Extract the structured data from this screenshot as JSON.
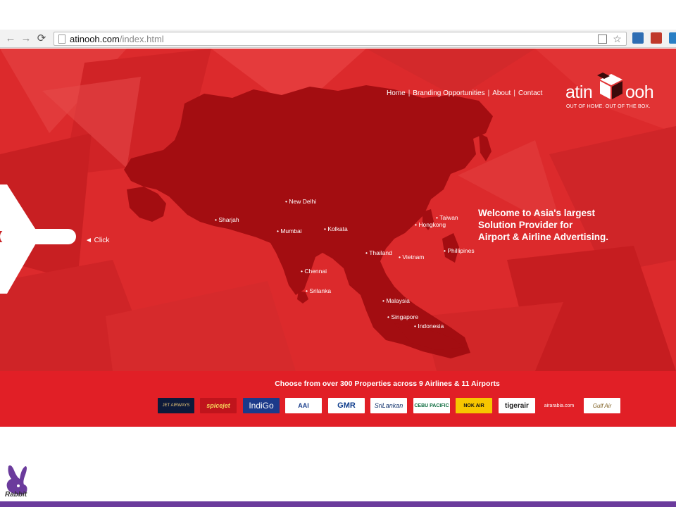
{
  "browser": {
    "url_host": "atinooh.com",
    "url_path": "/index.html",
    "icons": [
      "back-icon",
      "forward-icon",
      "reload-icon",
      "page-icon",
      "bookmark-star-icon"
    ]
  },
  "site": {
    "nav": [
      {
        "label": "Home"
      },
      {
        "label": "Branding Opportunities"
      },
      {
        "label": "About"
      },
      {
        "label": "Contact"
      }
    ],
    "logo": {
      "left": "atin",
      "right": "ooh",
      "tagline": "OUT OF HOME. OUT OF THE BOX."
    },
    "welcome_lines": [
      "Welcome to Asia's largest",
      "Solution Provider for",
      "Airport & Airline Advertising."
    ],
    "click_label": "◄ Click",
    "cities": [
      {
        "name": "New Delhi"
      },
      {
        "name": "Sharjah"
      },
      {
        "name": "Mumbai"
      },
      {
        "name": "Kolkata"
      },
      {
        "name": "Chennai"
      },
      {
        "name": "Srilanka"
      },
      {
        "name": "Thailand"
      },
      {
        "name": "Vietnam"
      },
      {
        "name": "Hongkong"
      },
      {
        "name": "Taiwan"
      },
      {
        "name": "Phillipines"
      },
      {
        "name": "Malaysia"
      },
      {
        "name": "Singapore"
      },
      {
        "name": "Indonesia"
      }
    ],
    "tagline": "Choose from over 300 Properties across 9 Airlines & 11 Airports",
    "airlines": [
      {
        "name": "JET AIRWAYS"
      },
      {
        "name": "spicejet"
      },
      {
        "name": "IndiGo"
      },
      {
        "name": "AAI"
      },
      {
        "name": "GMR"
      },
      {
        "name": "SriLankan"
      },
      {
        "name": "CEBU PACIFIC"
      },
      {
        "name": "NOK AIR"
      },
      {
        "name": "tigerair"
      },
      {
        "name": "airarabia.com"
      },
      {
        "name": "Gulf Air"
      }
    ]
  },
  "brand_footer": {
    "label": "Rabbit"
  },
  "colors": {
    "site_red": "#dc2a2c",
    "map_dark_red": "#a30d11",
    "band_red": "#e11f26",
    "footer_purple": "#6b3b9c"
  }
}
